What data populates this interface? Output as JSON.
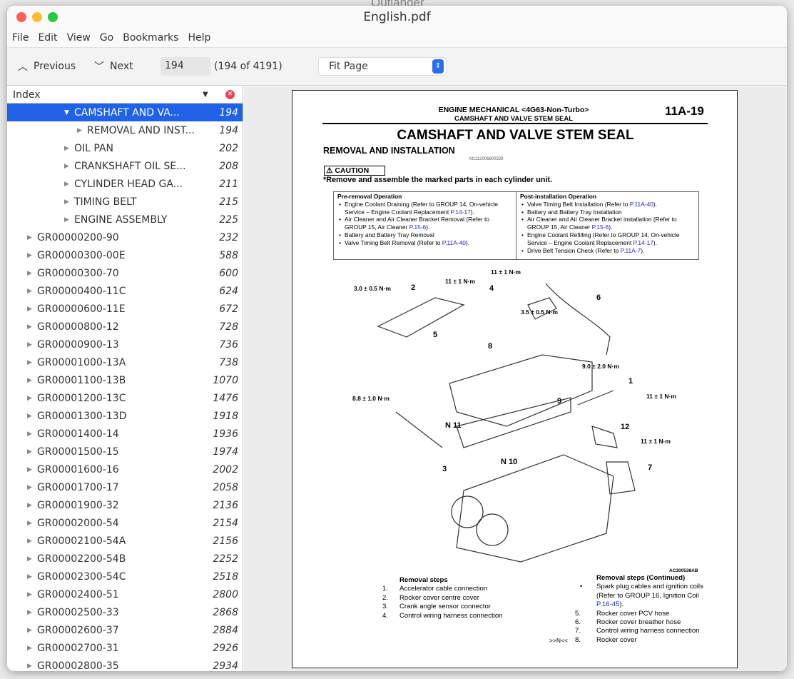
{
  "window": {
    "title": "English.pdf",
    "background_title": "Outlander"
  },
  "menu": [
    "File",
    "Edit",
    "View",
    "Go",
    "Bookmarks",
    "Help"
  ],
  "toolbar": {
    "previous": "Previous",
    "next": "Next",
    "page_value": "194",
    "page_count": "(194 of 4191)",
    "zoom": "Fit Page"
  },
  "sidebar": {
    "title": "Index",
    "items": [
      {
        "label": "CAMSHAFT AND VA...",
        "page": "194",
        "level": 2,
        "expanded": true,
        "selected": true
      },
      {
        "label": "REMOVAL AND INST...",
        "page": "194",
        "level": 3
      },
      {
        "label": "OIL PAN",
        "page": "202",
        "level": 2
      },
      {
        "label": "CRANKSHAFT OIL SE...",
        "page": "208",
        "level": 2
      },
      {
        "label": "CYLINDER HEAD GA...",
        "page": "211",
        "level": 2
      },
      {
        "label": "TIMING BELT",
        "page": "215",
        "level": 2
      },
      {
        "label": "ENGINE ASSEMBLY",
        "page": "225",
        "level": 2
      },
      {
        "label": "GR00000200-90",
        "page": "232",
        "level": 1
      },
      {
        "label": "GR00000300-00E",
        "page": "588",
        "level": 1
      },
      {
        "label": "GR00000300-70",
        "page": "600",
        "level": 1
      },
      {
        "label": "GR00000400-11C",
        "page": "624",
        "level": 1
      },
      {
        "label": "GR00000600-11E",
        "page": "672",
        "level": 1
      },
      {
        "label": "GR00000800-12",
        "page": "728",
        "level": 1
      },
      {
        "label": "GR00000900-13",
        "page": "736",
        "level": 1
      },
      {
        "label": "GR00001000-13A",
        "page": "738",
        "level": 1
      },
      {
        "label": "GR00001100-13B",
        "page": "1070",
        "level": 1
      },
      {
        "label": "GR00001200-13C",
        "page": "1476",
        "level": 1
      },
      {
        "label": "GR00001300-13D",
        "page": "1918",
        "level": 1
      },
      {
        "label": "GR00001400-14",
        "page": "1936",
        "level": 1
      },
      {
        "label": "GR00001500-15",
        "page": "1974",
        "level": 1
      },
      {
        "label": "GR00001600-16",
        "page": "2002",
        "level": 1
      },
      {
        "label": "GR00001700-17",
        "page": "2058",
        "level": 1
      },
      {
        "label": "GR00001900-32",
        "page": "2136",
        "level": 1
      },
      {
        "label": "GR00002000-54",
        "page": "2154",
        "level": 1
      },
      {
        "label": "GR00002100-54A",
        "page": "2156",
        "level": 1
      },
      {
        "label": "GR00002200-54B",
        "page": "2252",
        "level": 1
      },
      {
        "label": "GR00002300-54C",
        "page": "2518",
        "level": 1
      },
      {
        "label": "GR00002400-51",
        "page": "2800",
        "level": 1
      },
      {
        "label": "GR00002500-33",
        "page": "2868",
        "level": 1
      },
      {
        "label": "GR00002600-37",
        "page": "2884",
        "level": 1
      },
      {
        "label": "GR00002700-31",
        "page": "2926",
        "level": 1
      },
      {
        "label": "GR00002800-35",
        "page": "2934",
        "level": 1
      }
    ]
  },
  "pdf": {
    "header_line1": "ENGINE MECHANICAL <4G63-Non-Turbo>",
    "header_line2": "CAMSHAFT AND VALVE STEM SEAL",
    "page_no": "11A-19",
    "title": "CAMSHAFT AND VALVE STEM SEAL",
    "subtitle": "REMOVAL AND INSTALLATION",
    "doc_code": "M1112006600329",
    "caution": "⚠ CAUTION",
    "caution_text": "*Remove and assemble the marked parts in each cylinder unit.",
    "pre_title": "Pre-removal Operation",
    "pre": [
      {
        "text": "Engine Coolant Draining (Refer to GROUP 14, On-vehicle Service – Engine Coolant Replacement ",
        "link": "P.14-17",
        "end": ")."
      },
      {
        "text": "Air Cleaner and Air Cleaner Bracket Removal (Refer to GROUP 15, Air Cleaner ",
        "link": "P.15-6",
        "end": ")."
      },
      {
        "text": "Battery and Battery Tray Removal",
        "link": "",
        "end": ""
      },
      {
        "text": "Valve Timing Belt Removal (Refer to ",
        "link": "P.11A-40",
        "end": ")."
      }
    ],
    "post_title": "Post-installation Operation",
    "post": [
      {
        "text": "Valve Timing Belt Installation (Refer to ",
        "link": "P.11A-40",
        "end": ")."
      },
      {
        "text": "Battery and Battery Tray Installation",
        "link": "",
        "end": ""
      },
      {
        "text": "Air Cleaner and Air Cleaner Bracket installation (Refer to GROUP 15, Air Cleaner ",
        "link": "P.15-6",
        "end": ")."
      },
      {
        "text": "Engine Coolant Refilling (Refer to GROUP 14, On-vehicle Service – Engine Coolant Replacement ",
        "link": "P.14-17",
        "end": ")."
      },
      {
        "text": "Drive Belt Tension Check (Refer to ",
        "link": "P.11A-7",
        "end": ")."
      }
    ],
    "diagram_labels": [
      "3.0 ± 0.5 N·m",
      "2",
      "11 ± 1 N·m",
      "4",
      "11 ± 1 N·m",
      "6",
      "3.5 ± 0.5 N·m",
      "5",
      "8",
      "9.0 ± 2.0 N·m",
      "1",
      "11 ± 1 N·m",
      "8.8 ± 1.0 N·m",
      "9",
      "N 11",
      "12",
      "11 ± 1 N·m",
      "3",
      "N 10",
      "7"
    ],
    "figure_code": "AC300538AB",
    "steps_title": "Removal steps",
    "steps": [
      {
        "n": "1.",
        "t": "Accelerator cable connection"
      },
      {
        "n": "2.",
        "t": "Rocker cover centre cover"
      },
      {
        "n": "3.",
        "t": "Crank angle sensor connector"
      },
      {
        "n": "4.",
        "t": "Control wiring harness connection"
      }
    ],
    "steps2_title": "Removal steps (Continued)",
    "steps2_bullet": "Spark plug cables and ignition coils (Refer to GROUP 16, Ignition Coil ",
    "steps2_bullet_link": "P.16-45",
    "steps2_bullet_end": ").",
    "steps2": [
      {
        "n": "5.",
        "t": "Rocker cover PCV hose"
      },
      {
        "n": "6.",
        "t": "Rocker cover breather hose"
      },
      {
        "n": "7.",
        "t": "Control wiring harness connection"
      },
      {
        "n": "8.",
        "t": "Rocker cover",
        "mark": ">>N<<"
      }
    ]
  }
}
